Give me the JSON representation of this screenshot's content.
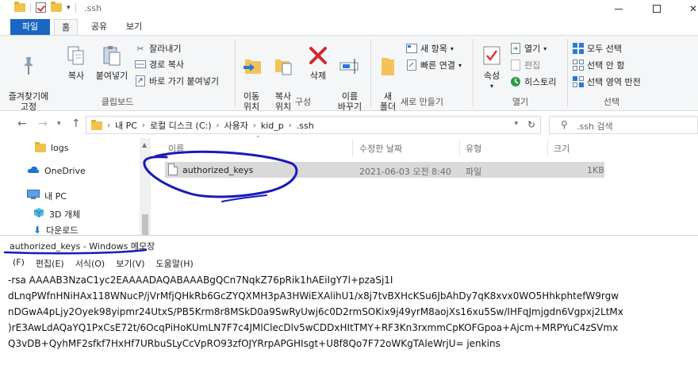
{
  "window": {
    "title": ".ssh"
  },
  "tabs": [
    "파일",
    "홈",
    "공유",
    "보기"
  ],
  "ribbon": {
    "clipboard": {
      "label": "클립보드",
      "pin": "즐겨찾기에\n고정",
      "copy": "복사",
      "paste": "붙여넣기",
      "cut": "잘라내기",
      "copy_path": "경로 복사",
      "paste_shortcut": "바로 가기 붙여넣기"
    },
    "organize": {
      "label": "구성",
      "move_to": "이동\n위치",
      "copy_to": "복사\n위치",
      "delete": "삭제",
      "rename": "이름\n바꾸기"
    },
    "new": {
      "label": "새로 만들기",
      "new_folder": "새\n폴더",
      "new_item": "새 항목",
      "easy_access": "빠른 연결"
    },
    "open": {
      "label": "열기",
      "properties": "속성",
      "open": "열기",
      "edit": "편집",
      "history": "히스토리"
    },
    "select": {
      "label": "선택",
      "select_all": "모두 선택",
      "select_none": "선택 안 함",
      "invert": "선택 영역 반전"
    }
  },
  "address": {
    "crumbs": [
      "내 PC",
      "로컬 디스크 (C:)",
      "사용자",
      "kid_p",
      ".ssh"
    ],
    "search_placeholder": ".ssh 검색"
  },
  "nav": {
    "items": [
      "logs",
      "OneDrive",
      "내 PC",
      "3D 개체",
      "다운로드"
    ]
  },
  "files": {
    "columns": {
      "name": "이름",
      "date": "수정한 날짜",
      "type": "유형",
      "size": "크기"
    },
    "rows": [
      {
        "name": "authorized_keys",
        "date": "2021-06-03 오전 8:40",
        "type": "파일",
        "size": "1KB"
      }
    ]
  },
  "notepad": {
    "title": "authorized_keys - Windows 메모장",
    "menu": [
      "(F)",
      "편집(E)",
      "서식(O)",
      "보기(V)",
      "도움말(H)"
    ],
    "lines": [
      "-rsa AAAAB3NzaC1yc2EAAAADAQABAAABgQCn7NqkZ76pRik1hAEiIgY7l+pzaSj1I",
      "dLnqPWfnHNiHAx118WNucP/jVrMfjQHkRb6GcZYQXMH3pA3HWiEXAlihU1/x8j7tvBXHcKSu6JbAhDy7qK8xvx0WO5HhkphtefW9rgw",
      "nDGwA4pLjy2Oyek98yipmr24UtxS/PB5Krm8r8MSkD0a9SwRyUwj6c0D2rmSOKix9j49yrM8aojXs16xu5Sw/IHFqJmjgdn6Vgpxj2LtMx",
      ")rE3AwLdAQaYQ1PxCsE72t/6OcqPiHoKUmLN7F7c4JMlClecDlv5wCDDxHItTMY+RF3Kn3rxmmCpKOFGpoa+Ajcm+MRPYuC4zSVmx",
      "Q3vDB+QyhMF2sfkf7HxHf7URbuSLyCcVpRO93zfOJYRrpAPGHIsgt+U8f8Qo7F72oWKgTAleWrjU= jenkins"
    ]
  },
  "colors": {
    "accent": "#1a67c3",
    "annotation": "#1a1ab8",
    "selection": "#d9d9d9"
  }
}
